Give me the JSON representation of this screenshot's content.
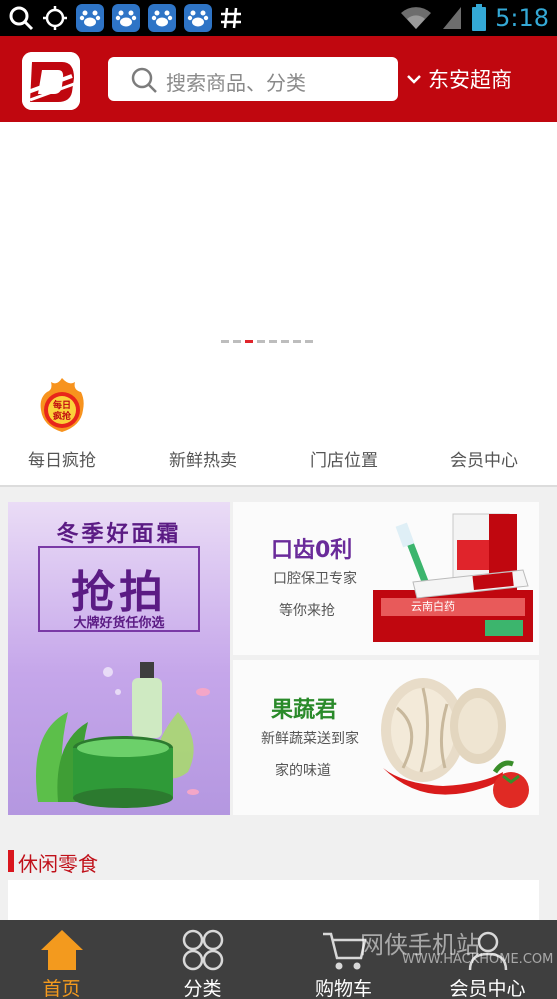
{
  "status_bar": {
    "time": "5:18",
    "icons": [
      "search-icon",
      "crosshair-icon",
      "baidu-paw-icon",
      "baidu-paw-icon",
      "baidu-paw-icon",
      "baidu-paw-icon",
      "hash-icon",
      "wifi-icon",
      "signal-icon",
      "battery-icon"
    ]
  },
  "header": {
    "search_placeholder": "搜索商品、分类",
    "store_name": "东安超商",
    "brand_color": "#c0070f"
  },
  "banner": {
    "dot_count": 8,
    "active_dot": 3
  },
  "quick_nav": [
    {
      "label": "每日疯抢",
      "icon": "daily-rush-badge-icon",
      "badge_text": "每日疯抢"
    },
    {
      "label": "新鲜热卖"
    },
    {
      "label": "门店位置"
    },
    {
      "label": "会员中心"
    }
  ],
  "promos": {
    "left": {
      "title": "冬季好面霜",
      "main": "抢拍",
      "sub": "大牌好货任你选"
    },
    "right_top": {
      "title": "口齿0利",
      "line1": "口腔保卫专家",
      "line2": "等你来抢",
      "product_text": "云南白药"
    },
    "right_bottom": {
      "title": "果蔬君",
      "line1": "新鲜蔬菜送到家",
      "line2": "家的味道"
    }
  },
  "section": {
    "title": "休闲零食"
  },
  "bottom_nav": [
    {
      "label": "首页",
      "icon": "home-icon",
      "active": true
    },
    {
      "label": "分类",
      "icon": "category-icon",
      "active": false
    },
    {
      "label": "购物车",
      "icon": "cart-icon",
      "active": false
    },
    {
      "label": "会员中心",
      "icon": "member-icon",
      "active": false
    }
  ],
  "watermark": {
    "text": "网侠手机站",
    "url": "WWW.HACKHOME.COM"
  },
  "colors": {
    "accent": "#c0070f",
    "active_tab": "#f39a1e",
    "bottom_bar": "#3f3f3f"
  }
}
